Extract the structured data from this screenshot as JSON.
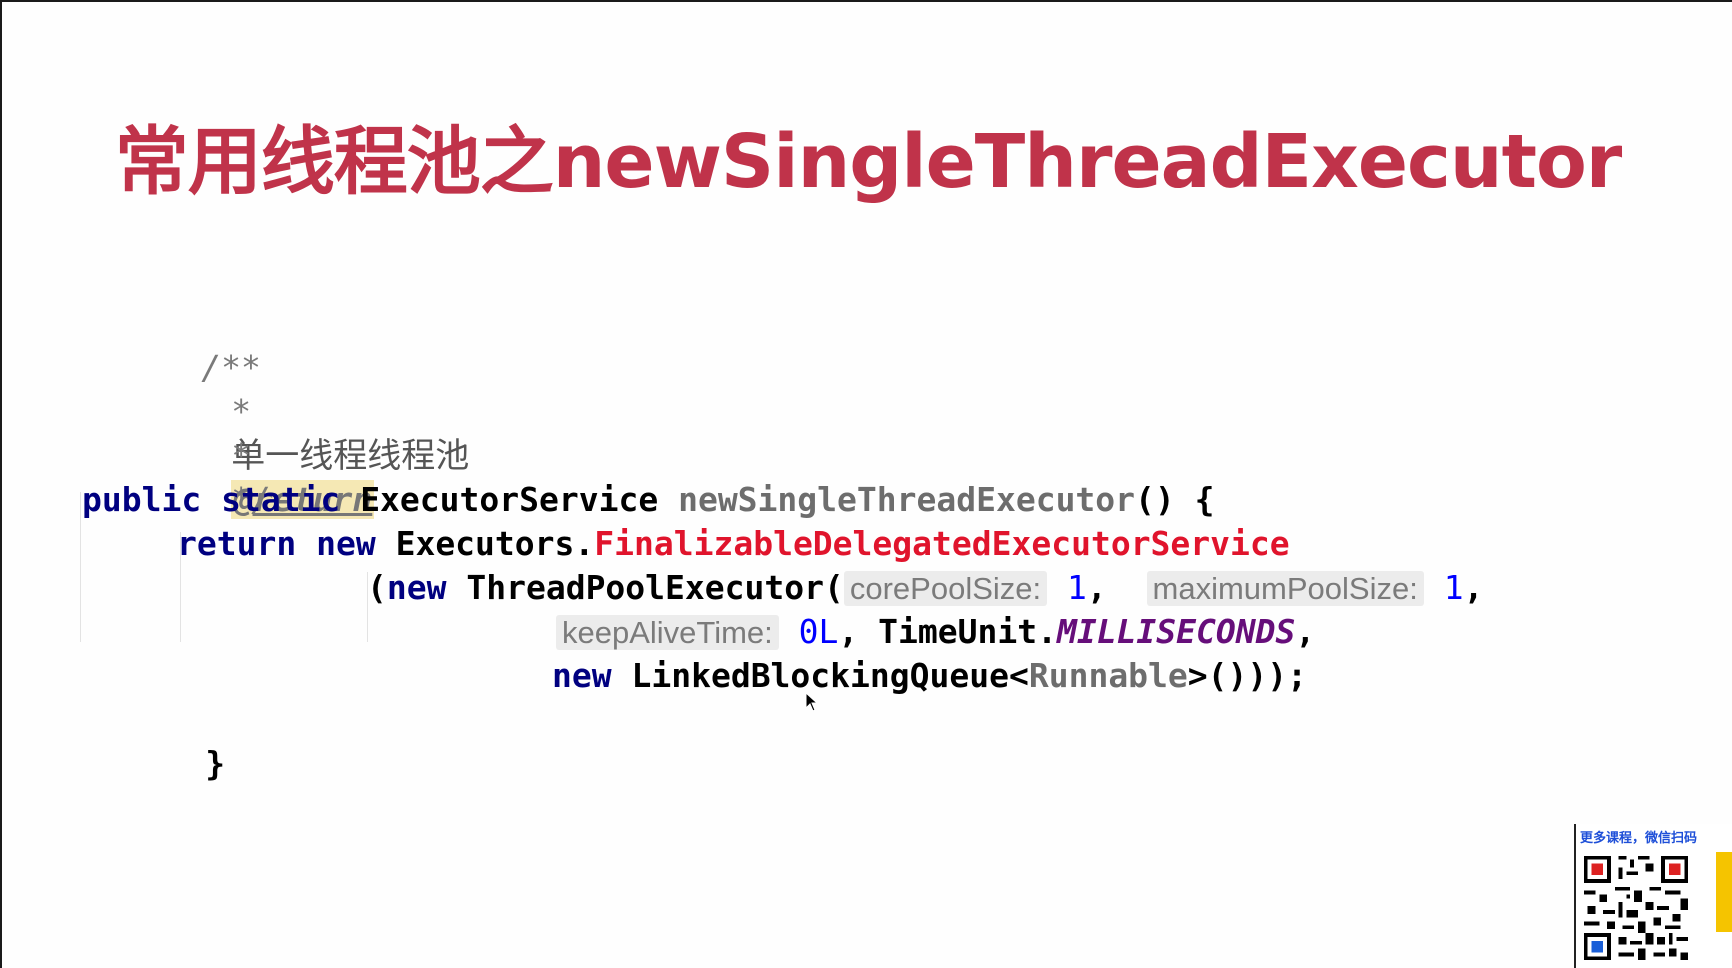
{
  "slide": {
    "title": "常用线程池之newSingleThreadExecutor"
  },
  "code": {
    "comment_open": "/**",
    "comment_star": "*",
    "comment_text": "单一线程线程池",
    "return_tag": "@return",
    "comment_close": "*/",
    "kw_public": "public",
    "kw_static": "static",
    "return_type": "ExecutorService",
    "method_name": "newSingleThreadExecutor",
    "method_parens_open": "() {",
    "kw_return": "return",
    "kw_new": "new",
    "executors": "Executors.",
    "finalizable": "FinalizableDelegatedExecutorService",
    "open_paren_new": "(new",
    "tpe": "ThreadPoolExecutor(",
    "hint_core": "corePoolSize:",
    "val_core": "1",
    "comma": ",",
    "hint_max": "maximumPoolSize:",
    "val_max": "1",
    "hint_keep": "keepAliveTime:",
    "val_keep": "0L",
    "timeunit": "TimeUnit.",
    "millis": "MILLISECONDS",
    "kw_new2": "new",
    "lbq": "LinkedBlockingQueue<",
    "runnable": "Runnable",
    "close_tail": ">()));",
    "close_brace": "}"
  },
  "qr": {
    "caption": "更多课程，微信扫码"
  },
  "colors": {
    "title": "#c0334a",
    "keyword": "#000080",
    "highlight_red": "#e0142c",
    "number": "#0000ff",
    "constant": "#660e7a"
  }
}
